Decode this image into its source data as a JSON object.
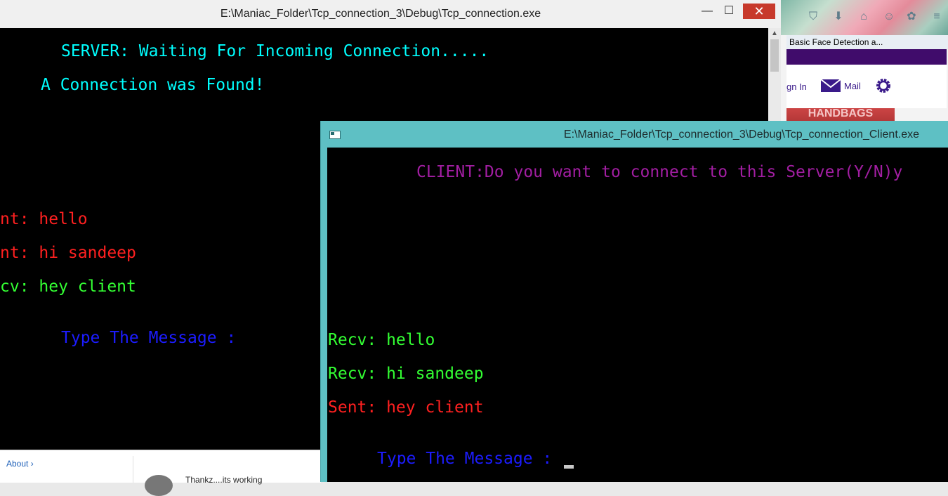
{
  "browser": {
    "tab_title": "Basic Face Detection a...",
    "signin_label": "gn In",
    "mail_label": "Mail",
    "banner_text": "HANDBAGS",
    "accent_color": "#400c6b",
    "toolbar_icons": [
      "pocket-icon",
      "download-icon",
      "home-icon",
      "smiley-icon",
      "menu-icon"
    ]
  },
  "server_window": {
    "title": "E:\\Maniac_Folder\\Tcp_connection_3\\Debug\\Tcp_connection.exe",
    "controls": {
      "minimize": "—",
      "maximize": "☐",
      "close": "✕"
    },
    "lines": {
      "waiting": "SERVER: Waiting For Incoming Connection.....",
      "found": "A Connection was Found!",
      "sent1": "nt: hello",
      "sent2": "nt: hi sandeep",
      "recv1": "cv: hey client",
      "prompt": "Type The Message :"
    }
  },
  "client_window": {
    "title": "E:\\Maniac_Folder\\Tcp_connection_3\\Debug\\Tcp_connection_Client.exe",
    "lines": {
      "question": "CLIENT:Do you want to connect to this Server(Y/N)y",
      "recv1": "Recv: hello",
      "recv2": "Recv: hi sandeep",
      "sent1": "Sent: hey client",
      "prompt": "Type The Message :"
    },
    "frame_color": "#5ec0c4"
  },
  "bottom_page": {
    "about_link": "About ›",
    "comment_text": "Thankz....its working"
  }
}
